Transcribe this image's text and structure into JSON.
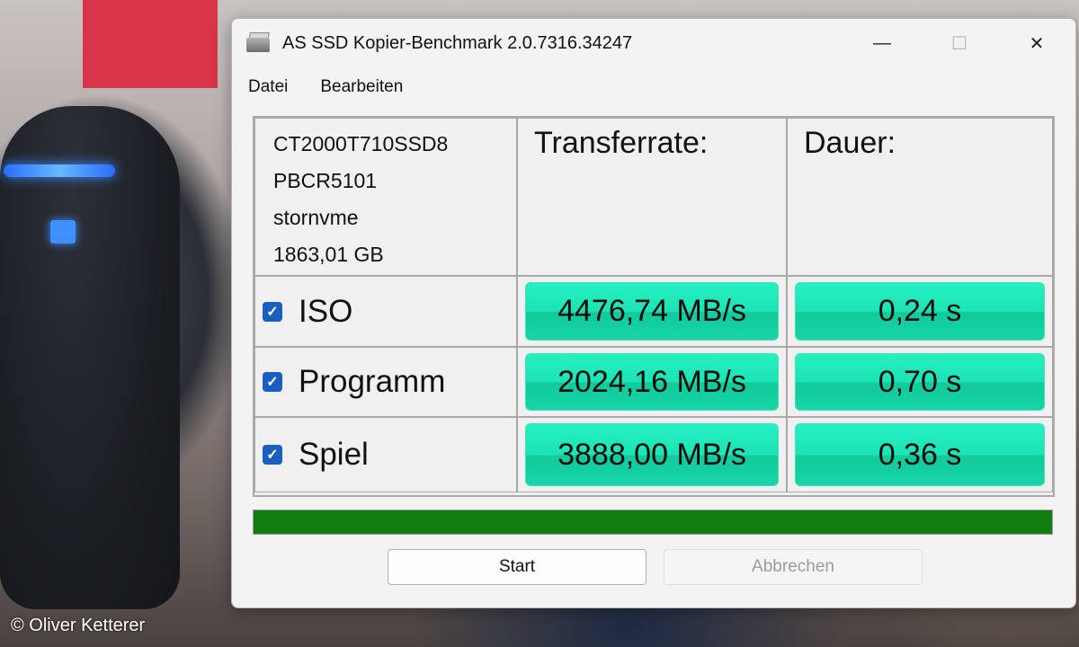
{
  "window": {
    "title": "AS SSD Kopier-Benchmark 2.0.7316.34247",
    "minimize_glyph": "—",
    "maximize_glyph": "☐",
    "close_glyph": "✕"
  },
  "menu": {
    "items": [
      "Datei",
      "Bearbeiten"
    ]
  },
  "drive": {
    "model": "CT2000T710SSD8",
    "firmware": "PBCR5101",
    "driver": "stornvme",
    "size": "1863,01 GB"
  },
  "columns": {
    "transfer": "Transferrate:",
    "duration": "Dauer:"
  },
  "rows": [
    {
      "label": "ISO",
      "checked": true,
      "rate": "4476,74 MB/s",
      "time": "0,24 s"
    },
    {
      "label": "Programm",
      "checked": true,
      "rate": "2024,16 MB/s",
      "time": "0,70 s"
    },
    {
      "label": "Spiel",
      "checked": true,
      "rate": "3888,00 MB/s",
      "time": "0,36 s"
    }
  ],
  "progress": {
    "percent": 100,
    "color": "#127e10"
  },
  "buttons": {
    "start": "Start",
    "cancel": "Abbrechen"
  },
  "checkbox_glyph": "✓",
  "credit": "© Oliver Ketterer",
  "colors": {
    "value_cell": "#1de3b5",
    "checkbox": "#1a5fc0"
  }
}
